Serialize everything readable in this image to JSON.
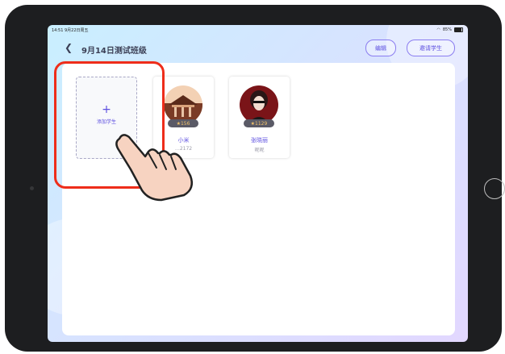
{
  "status_bar": {
    "time": "14:51  9月22日周五",
    "battery": "85%"
  },
  "header": {
    "title": "9月14日测试班级",
    "edit_label": "编辑",
    "invite_label": "邀请学生"
  },
  "add_student": {
    "label": "添加学生",
    "plus": "+"
  },
  "students": [
    {
      "name": "小米",
      "sub": "…2172",
      "points": "★156"
    },
    {
      "name": "张晓丽",
      "sub": "昵昵",
      "points": "★1129"
    }
  ],
  "colors": {
    "accent": "#5d4fe0",
    "highlight": "#ee2d1a"
  }
}
